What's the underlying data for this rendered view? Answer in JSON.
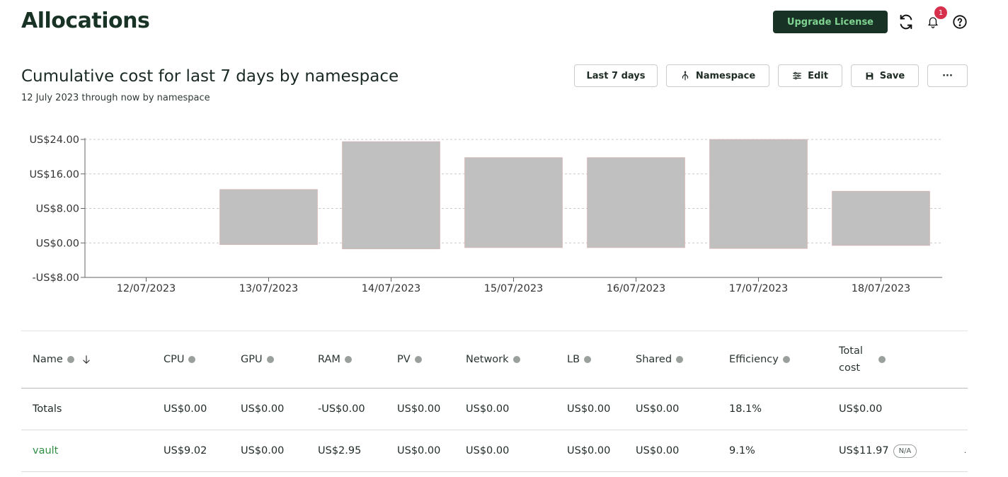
{
  "page": {
    "title": "Allocations"
  },
  "header": {
    "upgrade_label": "Upgrade License",
    "notification_count": "1"
  },
  "report": {
    "title": "Cumulative cost for last 7 days by namespace",
    "subtitle": "12 July 2023 through now by namespace"
  },
  "toolbar": {
    "date_range_label": "Last 7 days",
    "aggregate_label": "Namespace",
    "edit_label": "Edit",
    "save_label": "Save",
    "more_label": "···"
  },
  "chart_data": {
    "type": "bar",
    "categories": [
      "12/07/2023",
      "13/07/2023",
      "14/07/2023",
      "15/07/2023",
      "16/07/2023",
      "17/07/2023",
      "18/07/2023"
    ],
    "series": [
      {
        "values": [
          0,
          12.4,
          23.5,
          19.8,
          19.8,
          24.0,
          12.0
        ]
      },
      {
        "values": [
          0,
          -0.4,
          -1.4,
          -1.1,
          -1.1,
          -1.3,
          -0.6
        ]
      }
    ],
    "ylim": [
      -8,
      24
    ],
    "yticks": [
      "US$24.00",
      "US$16.00",
      "US$8.00",
      "US$0.00",
      "-US$8.00"
    ],
    "ytick_values": [
      24,
      16,
      8,
      0,
      -8
    ],
    "grid": true,
    "bar_color": "#c0c0c0"
  },
  "table": {
    "columns": [
      {
        "label": "Name",
        "info": true,
        "sort": true
      },
      {
        "label": "CPU",
        "info": true
      },
      {
        "label": "GPU",
        "info": true
      },
      {
        "label": "RAM",
        "info": true
      },
      {
        "label": "PV",
        "info": true
      },
      {
        "label": "Network",
        "info": true
      },
      {
        "label": "LB",
        "info": true
      },
      {
        "label": "Shared",
        "info": true
      },
      {
        "label": "Efficiency",
        "info": true
      },
      {
        "label": "Total cost",
        "info": true
      }
    ],
    "totals": [
      "Totals",
      "US$0.00",
      "US$0.00",
      "-US$0.00",
      "US$0.00",
      "US$0.00",
      "US$0.00",
      "US$0.00",
      "18.1%",
      "US$0.00"
    ],
    "rows": [
      {
        "cells": [
          "vault",
          "US$9.02",
          "US$0.00",
          "US$2.95",
          "US$0.00",
          "US$0.00",
          "US$0.00",
          "US$0.00",
          "9.1%",
          "US$11.97"
        ],
        "badge": "N/A"
      }
    ]
  }
}
